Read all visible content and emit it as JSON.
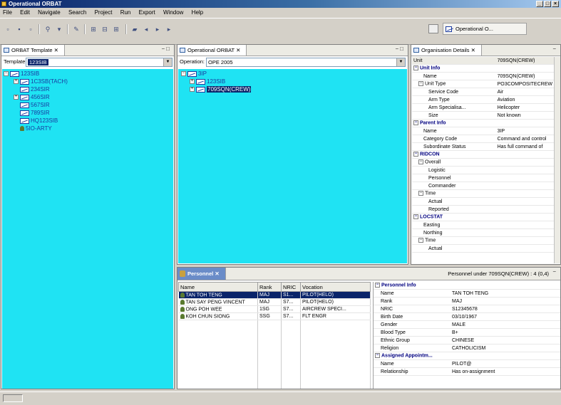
{
  "window": {
    "title": "Operational ORBAT",
    "controls": [
      "_",
      "□",
      "×"
    ]
  },
  "menu": [
    "File",
    "Edit",
    "Navigate",
    "Search",
    "Project",
    "Run",
    "Export",
    "Window",
    "Help"
  ],
  "perspective": {
    "label": "Operational O..."
  },
  "template_panel": {
    "tab": "ORBAT Template",
    "label": "Template:",
    "value": "123SIB",
    "tree": [
      {
        "label": "123SIB",
        "level": 0,
        "expander": "-"
      },
      {
        "label": "1C3SB(TACH)",
        "level": 1,
        "expander": "+"
      },
      {
        "label": "234SIR",
        "level": 1,
        "expander": ""
      },
      {
        "label": "456SIR",
        "level": 1,
        "expander": "+"
      },
      {
        "label": "567SIR",
        "level": 1,
        "expander": ""
      },
      {
        "label": "789SIR",
        "level": 1,
        "expander": ""
      },
      {
        "label": "HQ123SIB",
        "level": 1,
        "expander": ""
      },
      {
        "label": "5IO-ARTY",
        "level": 1,
        "expander": "",
        "person": true
      }
    ]
  },
  "orbat_panel": {
    "tab": "Operational ORBAT",
    "label": "Operation:",
    "value": "OPE 2005",
    "tree": [
      {
        "label": "3IP",
        "level": 0,
        "expander": "-"
      },
      {
        "label": "123SIB",
        "level": 1,
        "expander": "+"
      },
      {
        "label": "709SQN(CREW)",
        "level": 1,
        "expander": "+"
      }
    ]
  },
  "org_panel": {
    "tab": "Organisation Details",
    "header": {
      "k": "Unit",
      "v": "709SQN(CREW)"
    },
    "rows": [
      {
        "sec": true,
        "k": "Unit Info",
        "v": ""
      },
      {
        "k": "Name",
        "v": "709SQN(CREW)",
        "indent": 2
      },
      {
        "k": "Unit Type",
        "v": "PO3COMPOSITECREW",
        "indent": 1,
        "exp": true
      },
      {
        "k": "Service Code",
        "v": "Air",
        "indent": 3
      },
      {
        "k": "Arm Type",
        "v": "Aviation",
        "indent": 3
      },
      {
        "k": "Arm Specialisa...",
        "v": "Helicopter",
        "indent": 3
      },
      {
        "k": "Size",
        "v": "Not known",
        "indent": 3
      },
      {
        "sec": true,
        "k": "Parent Info",
        "v": ""
      },
      {
        "k": "Name",
        "v": "3IP",
        "indent": 2
      },
      {
        "k": "Category Code",
        "v": "Command and control",
        "indent": 2
      },
      {
        "k": "Subordinate Status",
        "v": "Has full command of",
        "indent": 2
      },
      {
        "sec": true,
        "k": "RIDCON",
        "v": ""
      },
      {
        "k": "Overall",
        "v": "",
        "indent": 1,
        "exp": true
      },
      {
        "k": "Logistic",
        "v": "",
        "indent": 3
      },
      {
        "k": "Personnel",
        "v": "",
        "indent": 3
      },
      {
        "k": "Commander",
        "v": "",
        "indent": 3
      },
      {
        "k": "Time",
        "v": "",
        "indent": 1,
        "exp": true
      },
      {
        "k": "Actual",
        "v": "",
        "indent": 3
      },
      {
        "k": "Reported",
        "v": "",
        "indent": 3
      },
      {
        "sec": true,
        "k": "LOCSTAT",
        "v": ""
      },
      {
        "k": "Easting",
        "v": "",
        "indent": 2
      },
      {
        "k": "Northing",
        "v": "",
        "indent": 2
      },
      {
        "k": "Time",
        "v": "",
        "indent": 1,
        "exp": true
      },
      {
        "k": "Actual",
        "v": "",
        "indent": 3
      }
    ]
  },
  "personnel_panel": {
    "tab": "Personnel",
    "summary": "Personnel under 709SQN(CREW) : 4 (0,4)",
    "columns": [
      "Name",
      "Rank",
      "NRIC",
      "Vocation"
    ],
    "rows": [
      {
        "name": "TAN TOH TENG",
        "rank": "MAJ",
        "nric": "S1...",
        "vocation": "PILOT(HELO)",
        "selected": true
      },
      {
        "name": "TAN SAY PENG VINCENT",
        "rank": "MAJ",
        "nric": "S7...",
        "vocation": "PILOT(HELO)"
      },
      {
        "name": "ONG POH WEE",
        "rank": "1SG",
        "nric": "S7...",
        "vocation": "AIRCREW SPECI..."
      },
      {
        "name": "KOH CHUN SIONG",
        "rank": "SSG",
        "nric": "S7...",
        "vocation": "FLT ENGR"
      }
    ],
    "details": [
      {
        "sec": true,
        "k": "Personnel Info",
        "v": ""
      },
      {
        "k": "Name",
        "v": "TAN TOH TENG"
      },
      {
        "k": "Rank",
        "v": "MAJ"
      },
      {
        "k": "NRIC",
        "v": "S12345678"
      },
      {
        "k": "Birth Date",
        "v": "03/10/1967"
      },
      {
        "k": "Gender",
        "v": "MALE"
      },
      {
        "k": "Blood Type",
        "v": "B+"
      },
      {
        "k": "Ethnic Group",
        "v": "CHINESE"
      },
      {
        "k": "Religion",
        "v": "CATHOLICISM"
      },
      {
        "sec": true,
        "k": "Assigned Appointm...",
        "v": ""
      },
      {
        "k": "Name",
        "v": "PILOT@"
      },
      {
        "k": "Relationship",
        "v": "Has on-assignment"
      }
    ]
  }
}
